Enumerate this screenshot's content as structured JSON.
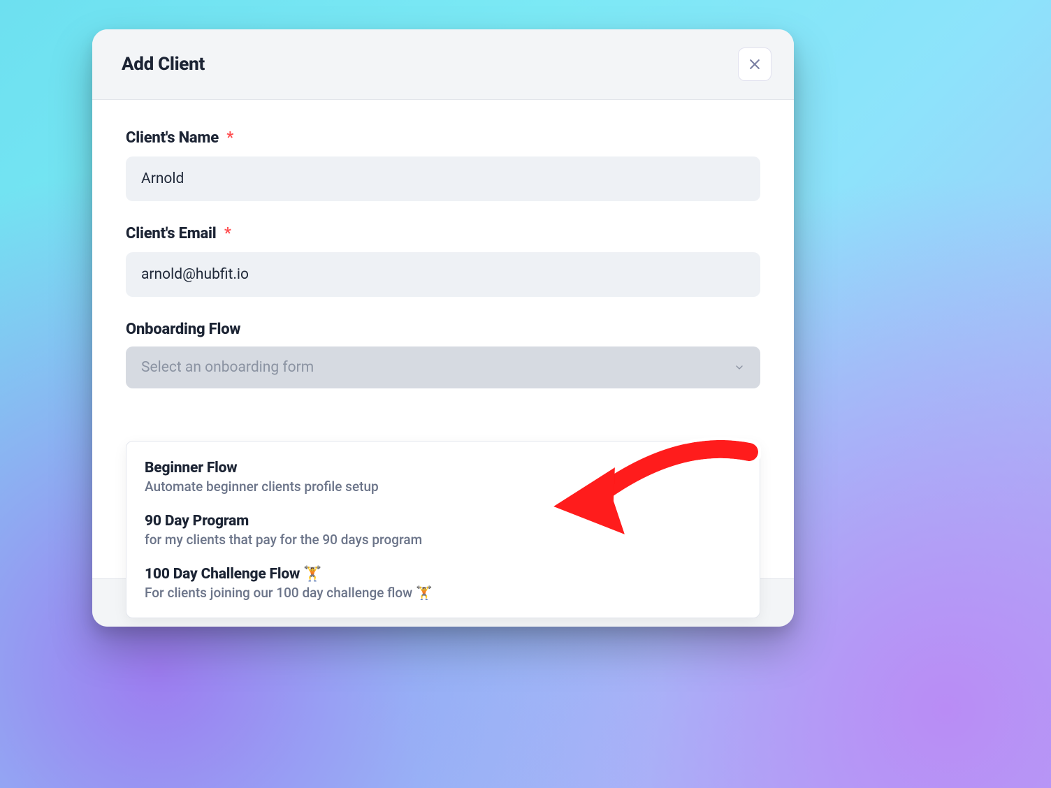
{
  "modal": {
    "title": "Add Client",
    "fields": {
      "name": {
        "label": "Client's Name",
        "required_mark": "*",
        "value": "Arnold"
      },
      "email": {
        "label": "Client's Email",
        "required_mark": "*",
        "value": "arnold@hubfit.io"
      },
      "onboarding": {
        "label": "Onboarding Flow",
        "placeholder": "Select an onboarding form"
      }
    },
    "dropdown": {
      "options": [
        {
          "title": "Beginner Flow",
          "desc": "Automate beginner clients profile setup"
        },
        {
          "title": "90 Day Program",
          "desc": "for my clients that pay for the 90 days program"
        },
        {
          "title": "100 Day Challenge Flow 🏋️",
          "desc": "For clients joining our 100 day challenge flow 🏋️"
        }
      ]
    }
  }
}
